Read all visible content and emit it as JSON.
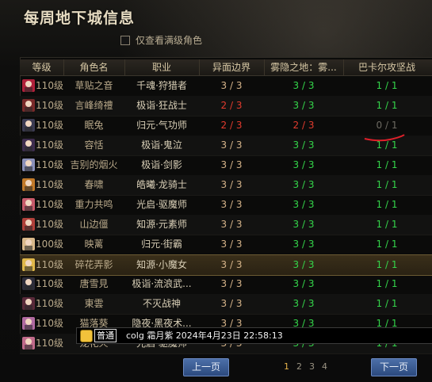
{
  "title": "每周地下城信息",
  "filter_label": "仅查看满级角色",
  "columns": [
    "等级",
    "角色名",
    "职业",
    "异面边界",
    "雾隐之地：雾...",
    "巴卡尔攻坚战"
  ],
  "rows": [
    {
      "level": "110级",
      "name": "草贴之音",
      "job": "千魂·狩猎者",
      "c1": "3 / 3",
      "c2": "3 / 3",
      "c3": "1 / 1",
      "c1s": "orange",
      "c2s": "green",
      "c3s": "green",
      "av": "#b0203a"
    },
    {
      "level": "110级",
      "name": "言峰绮禮",
      "job": "极诣·狂战士",
      "c1": "2 / 3",
      "c2": "3 / 3",
      "c3": "1 / 1",
      "c1s": "red",
      "c2s": "green",
      "c3s": "green",
      "av": "#7a2a2a"
    },
    {
      "level": "110级",
      "name": "眠兔",
      "job": "归元·气功师",
      "c1": "2 / 3",
      "c2": "2 / 3",
      "c3": "0 / 1",
      "c1s": "red",
      "c2s": "red",
      "c3s": "gray",
      "av": "#3b3b52"
    },
    {
      "level": "110级",
      "name": "容恬",
      "job": "极诣·鬼泣",
      "c1": "3 / 3",
      "c2": "3 / 3",
      "c3": "1 / 1",
      "c1s": "orange",
      "c2s": "green",
      "c3s": "green",
      "av": "#3e2d4f"
    },
    {
      "level": "110级",
      "name": "吉别的烟火",
      "job": "极诣·剑影",
      "c1": "3 / 3",
      "c2": "3 / 3",
      "c3": "1 / 1",
      "c1s": "orange",
      "c2s": "green",
      "c3s": "green",
      "av": "#8a8fb8"
    },
    {
      "level": "110级",
      "name": "春啸",
      "job": "皓曦·龙骑士",
      "c1": "3 / 3",
      "c2": "3 / 3",
      "c3": "1 / 1",
      "c1s": "orange",
      "c2s": "green",
      "c3s": "green",
      "av": "#c27a2a"
    },
    {
      "level": "110级",
      "name": "重力共鸣",
      "job": "光启·驱魔师",
      "c1": "3 / 3",
      "c2": "3 / 3",
      "c3": "1 / 1",
      "c1s": "orange",
      "c2s": "green",
      "c3s": "green",
      "av": "#c75a6a"
    },
    {
      "level": "110级",
      "name": "山边僵",
      "job": "知源·元素师",
      "c1": "3 / 3",
      "c2": "3 / 3",
      "c3": "1 / 1",
      "c1s": "orange",
      "c2s": "green",
      "c3s": "green",
      "av": "#b0403a"
    },
    {
      "level": "100级",
      "name": "映蓠",
      "job": "归元·街霸",
      "c1": "3 / 3",
      "c2": "3 / 3",
      "c3": "1 / 1",
      "c1s": "orange",
      "c2s": "green",
      "c3s": "green",
      "av": "#d8b88a"
    },
    {
      "level": "110级",
      "name": "碎花弄影",
      "job": "知源·小魔女",
      "c1": "3 / 3",
      "c2": "3 / 3",
      "c3": "1 / 1",
      "c1s": "orange",
      "c2s": "green",
      "c3s": "green",
      "av": "#e0b84a"
    },
    {
      "level": "110级",
      "name": "唐雪見",
      "job": "极诣·流浪武...",
      "c1": "3 / 3",
      "c2": "3 / 3",
      "c3": "1 / 1",
      "c1s": "orange",
      "c2s": "green",
      "c3s": "green",
      "av": "#2d2d3a"
    },
    {
      "level": "110级",
      "name": "東雲",
      "job": "不灭战神",
      "c1": "3 / 3",
      "c2": "3 / 3",
      "c3": "1 / 1",
      "c1s": "orange",
      "c2s": "green",
      "c3s": "green",
      "av": "#5a2a3a"
    },
    {
      "level": "110级",
      "name": "猫落葵",
      "job": "隐夜·黑夜术...",
      "c1": "3 / 3",
      "c2": "3 / 3",
      "c3": "1 / 1",
      "c1s": "orange",
      "c2s": "green",
      "c3s": "green",
      "av": "#b06aa0"
    },
    {
      "level": "110级",
      "name": "龙花火",
      "job": "光启·驱魔师",
      "c1": "3 / 3",
      "c2": "3 / 3",
      "c3": "1 / 1",
      "c1s": "orange",
      "c2s": "green",
      "c3s": "green",
      "av": "#c06a8a"
    }
  ],
  "chat": {
    "channel": "普通",
    "text": "colg    霜月紫    2024年4月23日 22:58:13"
  },
  "pagination": {
    "prev": "上一页",
    "next": "下一页",
    "pages": [
      "1",
      "2",
      "3",
      "4"
    ],
    "current": "1"
  }
}
